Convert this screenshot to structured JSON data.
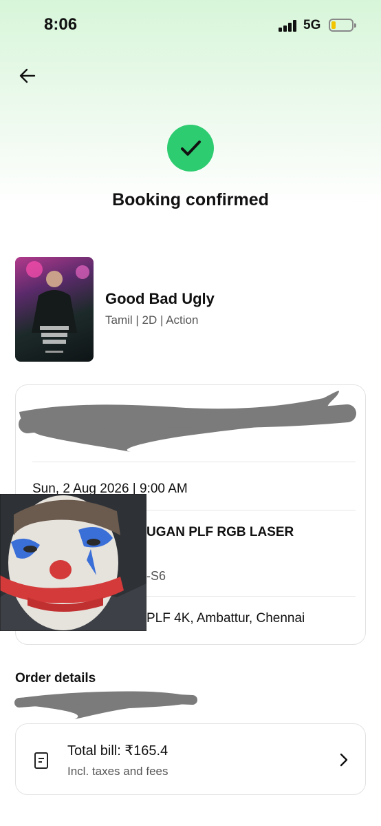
{
  "status_bar": {
    "time": "8:06",
    "network": "5G",
    "battery_level": 0.2,
    "battery_color": "#f2c500"
  },
  "header": {
    "back_icon": "arrow-left-icon"
  },
  "confirmation": {
    "icon": "check-icon",
    "accent_color": "#2ecc71",
    "title": "Booking confirmed"
  },
  "movie": {
    "name": "Good Bad Ugly",
    "meta": "Tamil | 2D | Action"
  },
  "booking": {
    "datetime": "Sun, 2 Aug 2026 | 9:00 AM",
    "screen": "UGAN PLF RGB LASER",
    "seats": "-S6",
    "venue": "PLF 4K, Ambattur, Chennai"
  },
  "order": {
    "section_title": "Order details",
    "total_label": "Total bill: ₹165.4",
    "total_sub": "Incl. taxes and fees",
    "bill_icon": "receipt-icon",
    "chevron_icon": "chevron-right-icon"
  }
}
